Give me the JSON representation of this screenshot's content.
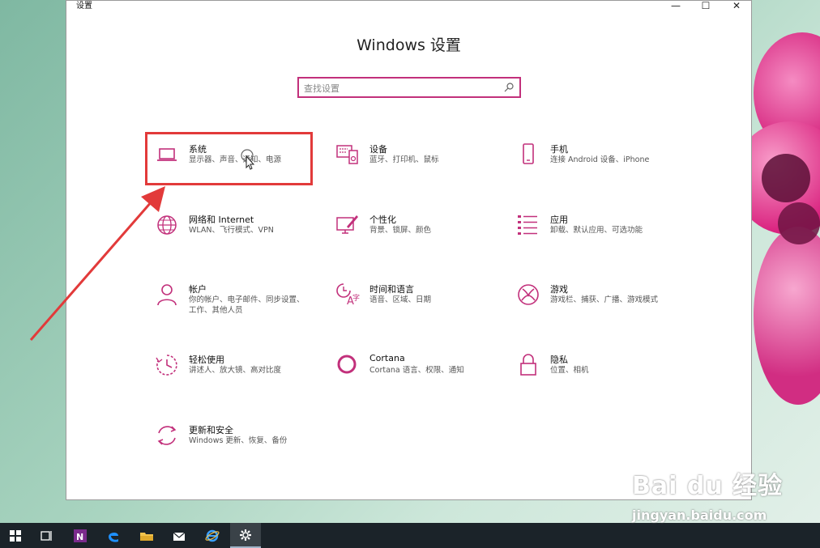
{
  "window": {
    "title": "设置",
    "controls": {
      "minimize": "—",
      "maximize": "☐",
      "close": "✕"
    }
  },
  "header": {
    "title": "Windows 设置"
  },
  "search": {
    "placeholder": "查找设置"
  },
  "colors": {
    "accent": "#c2307b",
    "highlight": "#e23a3a",
    "taskbar": "#1b2329"
  },
  "tiles": [
    {
      "name": "系统",
      "desc": "显示器、声音、通知、电源",
      "icon": "laptop-icon"
    },
    {
      "name": "设备",
      "desc": "蓝牙、打印机、鼠标",
      "icon": "keyboard-icon"
    },
    {
      "name": "手机",
      "desc": "连接 Android 设备、iPhone",
      "icon": "phone-icon"
    },
    {
      "name": "网络和 Internet",
      "desc": "WLAN、飞行模式、VPN",
      "icon": "globe-icon"
    },
    {
      "name": "个性化",
      "desc": "背景、锁屏、颜色",
      "icon": "paint-icon"
    },
    {
      "name": "应用",
      "desc": "卸载、默认应用、可选功能",
      "icon": "apps-list-icon"
    },
    {
      "name": "帐户",
      "desc": "你的帐户、电子邮件、同步设置、工作、其他人员",
      "icon": "person-icon"
    },
    {
      "name": "时间和语言",
      "desc": "语音、区域、日期",
      "icon": "time-language-icon"
    },
    {
      "name": "游戏",
      "desc": "游戏栏、捕获、广播、游戏模式",
      "icon": "xbox-icon"
    },
    {
      "name": "轻松使用",
      "desc": "讲述人、放大镜、高对比度",
      "icon": "ease-of-access-icon"
    },
    {
      "name": "Cortana",
      "desc": "Cortana 语言、权限、通知",
      "icon": "cortana-icon"
    },
    {
      "name": "隐私",
      "desc": "位置、相机",
      "icon": "lock-icon"
    },
    {
      "name": "更新和安全",
      "desc": "Windows 更新、恢复、备份",
      "icon": "update-icon"
    }
  ],
  "taskbar": {
    "items": [
      "windows-start-icon",
      "task-view-icon",
      "onenote-icon",
      "edge-icon",
      "file-explorer-icon",
      "mail-icon",
      "internet-explorer-icon",
      "settings-gear-icon"
    ],
    "onenote_letter": "N"
  },
  "watermark": {
    "logo": "Bai du 经验",
    "url": "jingyan.baidu.com"
  }
}
